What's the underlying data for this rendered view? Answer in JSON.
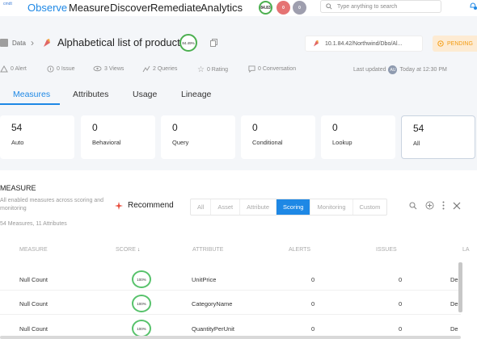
{
  "nav": {
    "logo": "cmdt",
    "items": [
      "Observe",
      "Measure",
      "Discover",
      "Remediate",
      "Analytics"
    ],
    "active": "Observe",
    "scores": [
      {
        "label": "84.83",
        "color": "#e8f5e9",
        "text_color": "#333",
        "border": "#4caf50"
      },
      {
        "label": "0",
        "color": "#e57373",
        "text_color": "#fff",
        "border": "#e57373"
      },
      {
        "label": "0",
        "color": "#9e9eae",
        "text_color": "#fff",
        "border": "#9e9eae"
      }
    ],
    "search_placeholder": "Type anything to search"
  },
  "breadcrumb": {
    "root": "Data",
    "title": "Alphabetical list of products",
    "title_score": "84.49%",
    "connection": "10.1.84.42/Northwind/Dbo/Al...",
    "status": "PENDING"
  },
  "stats": {
    "alert": "0 Alert",
    "issue": "0 Issue",
    "views": "3 Views",
    "queries": "2 Queries",
    "rating": "0 Rating",
    "conversation": "0 Conversation",
    "updated_label": "Last updated",
    "avatar": "AU",
    "updated_time": "Today at 12:30 PM"
  },
  "tabs": [
    "Measures",
    "Attributes",
    "Usage",
    "Lineage"
  ],
  "active_tab": "Measures",
  "cards": [
    {
      "num": "54",
      "label": "Auto"
    },
    {
      "num": "0",
      "label": "Behavioral"
    },
    {
      "num": "0",
      "label": "Query"
    },
    {
      "num": "0",
      "label": "Conditional"
    },
    {
      "num": "0",
      "label": "Lookup"
    },
    {
      "num": "54",
      "label": "All"
    }
  ],
  "panel": {
    "title": "MEASURE",
    "description": "All enabled measures across scoring and monitoring",
    "count": "54 Measures, 11 Attributes",
    "recommend": "Recommend",
    "filters": [
      "All",
      "Asset",
      "Attribute",
      "Scoring",
      "Monitoring",
      "Custom"
    ],
    "active_filter": "Scoring"
  },
  "table": {
    "headers": [
      "MEASURE",
      "SCORE",
      "ATTRIBUTE",
      "ALERTS",
      "ISSUES",
      "LA"
    ],
    "rows": [
      {
        "measure": "Null Count",
        "score": "100%",
        "attribute": "UnitPrice",
        "alerts": "0",
        "issues": "0",
        "la": "De"
      },
      {
        "measure": "Null Count",
        "score": "100%",
        "attribute": "CategoryName",
        "alerts": "0",
        "issues": "0",
        "la": "De"
      },
      {
        "measure": "Null Count",
        "score": "100%",
        "attribute": "QuantityPerUnit",
        "alerts": "0",
        "issues": "0",
        "la": "De"
      }
    ]
  },
  "colors": {
    "accent": "#1e88e5",
    "score_green": "#57c26b",
    "pending_bg": "#fdebd3",
    "pending_text": "#f39c12"
  }
}
